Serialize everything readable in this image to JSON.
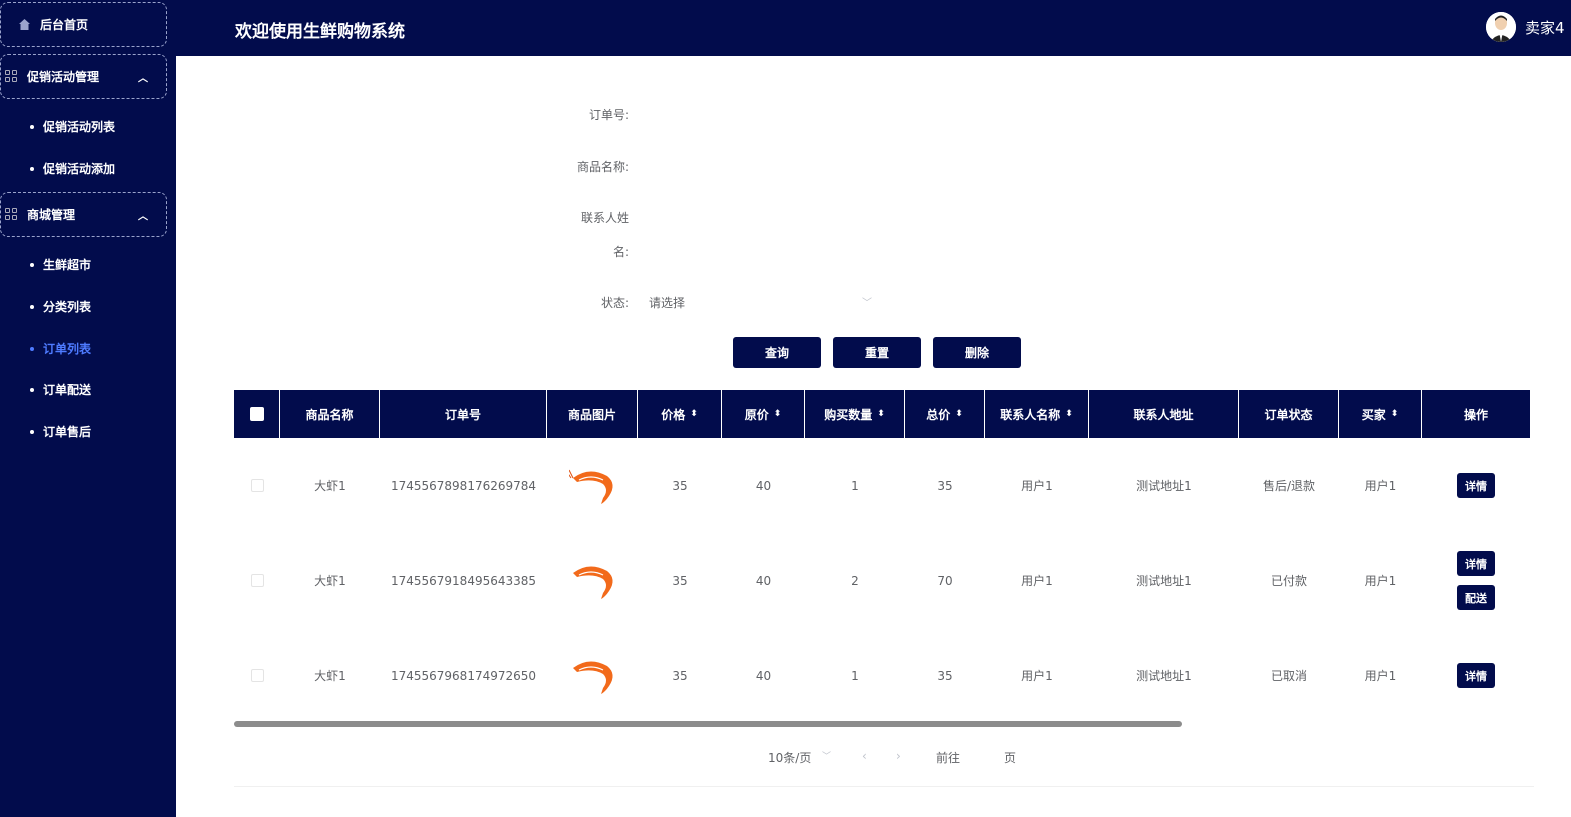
{
  "header": {
    "title": "欢迎使用生鲜购物系统",
    "user": "卖家4"
  },
  "sidebar": {
    "home": "后台首页",
    "groups": [
      {
        "label": "促销活动管理",
        "items": [
          "促销活动列表",
          "促销活动添加"
        ]
      },
      {
        "label": "商城管理",
        "items": [
          "生鲜超市",
          "分类列表",
          "订单列表",
          "订单配送",
          "订单售后"
        ]
      }
    ],
    "active_item": "订单列表"
  },
  "form": {
    "order_no_label": "订单号:",
    "product_name_label": "商品名称:",
    "contact_name_label_1": "联系人姓",
    "contact_name_label_2": "名:",
    "status_label": "状态:",
    "status_placeholder": "请选择"
  },
  "buttons": {
    "query": "查询",
    "reset": "重置",
    "delete": "删除"
  },
  "table": {
    "columns": [
      "商品名称",
      "订单号",
      "商品图片",
      "价格",
      "原价",
      "购买数量",
      "总价",
      "联系人名称",
      "联系人地址",
      "订单状态",
      "买家",
      "操作"
    ],
    "rows": [
      {
        "name": "大虾1",
        "order_no": "1745567898176269784",
        "price": "35",
        "orig": "40",
        "qty": "1",
        "total": "35",
        "contact": "用户1",
        "address": "测试地址1",
        "status": "售后/退款",
        "buyer": "用户1",
        "ops": [
          "详情"
        ]
      },
      {
        "name": "大虾1",
        "order_no": "1745567918495643385",
        "price": "35",
        "orig": "40",
        "qty": "2",
        "total": "70",
        "contact": "用户1",
        "address": "测试地址1",
        "status": "已付款",
        "buyer": "用户1",
        "ops": [
          "详情",
          "配送"
        ]
      },
      {
        "name": "大虾1",
        "order_no": "1745567968174972650",
        "price": "35",
        "orig": "40",
        "qty": "1",
        "total": "35",
        "contact": "用户1",
        "address": "测试地址1",
        "status": "已取消",
        "buyer": "用户1",
        "ops": [
          "详情"
        ]
      }
    ]
  },
  "pagination": {
    "page_size": "10条/页",
    "goto": "前往",
    "page": "页"
  }
}
